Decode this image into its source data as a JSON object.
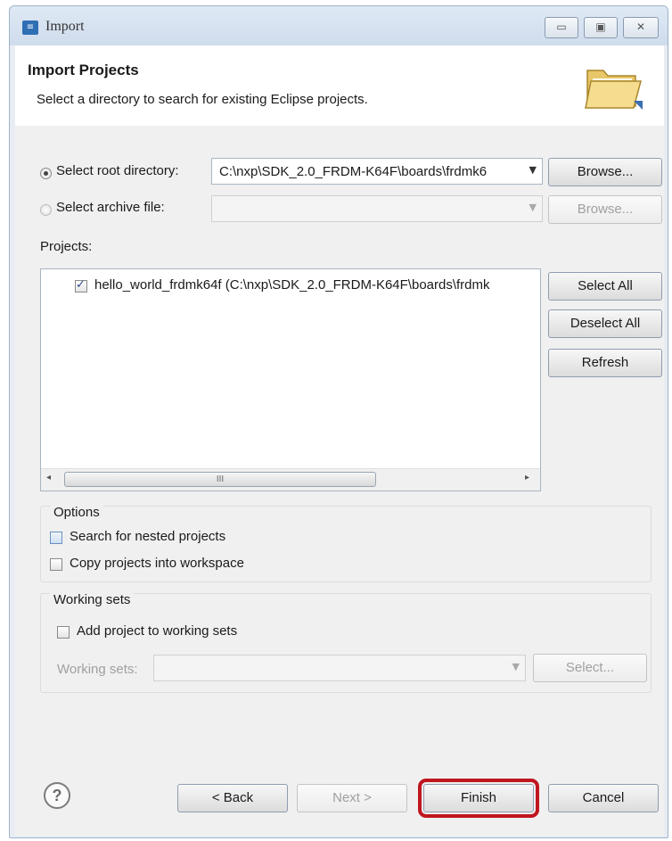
{
  "window": {
    "title": "Import",
    "app_icon": "eclipse-dialog-icon",
    "controls": {
      "minimize": "▭",
      "maximize": "▣",
      "close": "✕"
    }
  },
  "header": {
    "title": "Import Projects",
    "description": "Select a directory to search for existing Eclipse projects.",
    "icon": "folder-icon"
  },
  "source": {
    "root_label": "Select root directory:",
    "root_value": "C:\\nxp\\SDK_2.0_FRDM-K64F\\boards\\frdmk6",
    "root_selected": true,
    "archive_label": "Select archive file:",
    "archive_value": "",
    "browse_label": "Browse...",
    "browse_disabled_label": "Browse..."
  },
  "projects": {
    "label": "Projects:",
    "items": [
      {
        "label": "hello_world_frdmk64f (C:\\nxp\\SDK_2.0_FRDM-K64F\\boards\\frdmk",
        "checked": true
      }
    ],
    "select_all": "Select All",
    "deselect_all": "Deselect All",
    "refresh": "Refresh",
    "scroll_left": "◂",
    "scroll_right": "▸",
    "scroll_grip": "III"
  },
  "options": {
    "title": "Options",
    "nested_label": "Search for nested projects",
    "nested_checked": false,
    "copy_label": "Copy projects into workspace",
    "copy_checked": false
  },
  "working_sets": {
    "title": "Working sets",
    "add_label": "Add project to working sets",
    "add_checked": false,
    "field_label": "Working sets:",
    "field_value": "",
    "select_label": "Select..."
  },
  "footer": {
    "help": "?",
    "back": "< Back",
    "next": "Next >",
    "finish": "Finish",
    "cancel": "Cancel"
  },
  "colors": {
    "highlight": "#c0161f",
    "dialog_bg": "#f0f0f0"
  }
}
